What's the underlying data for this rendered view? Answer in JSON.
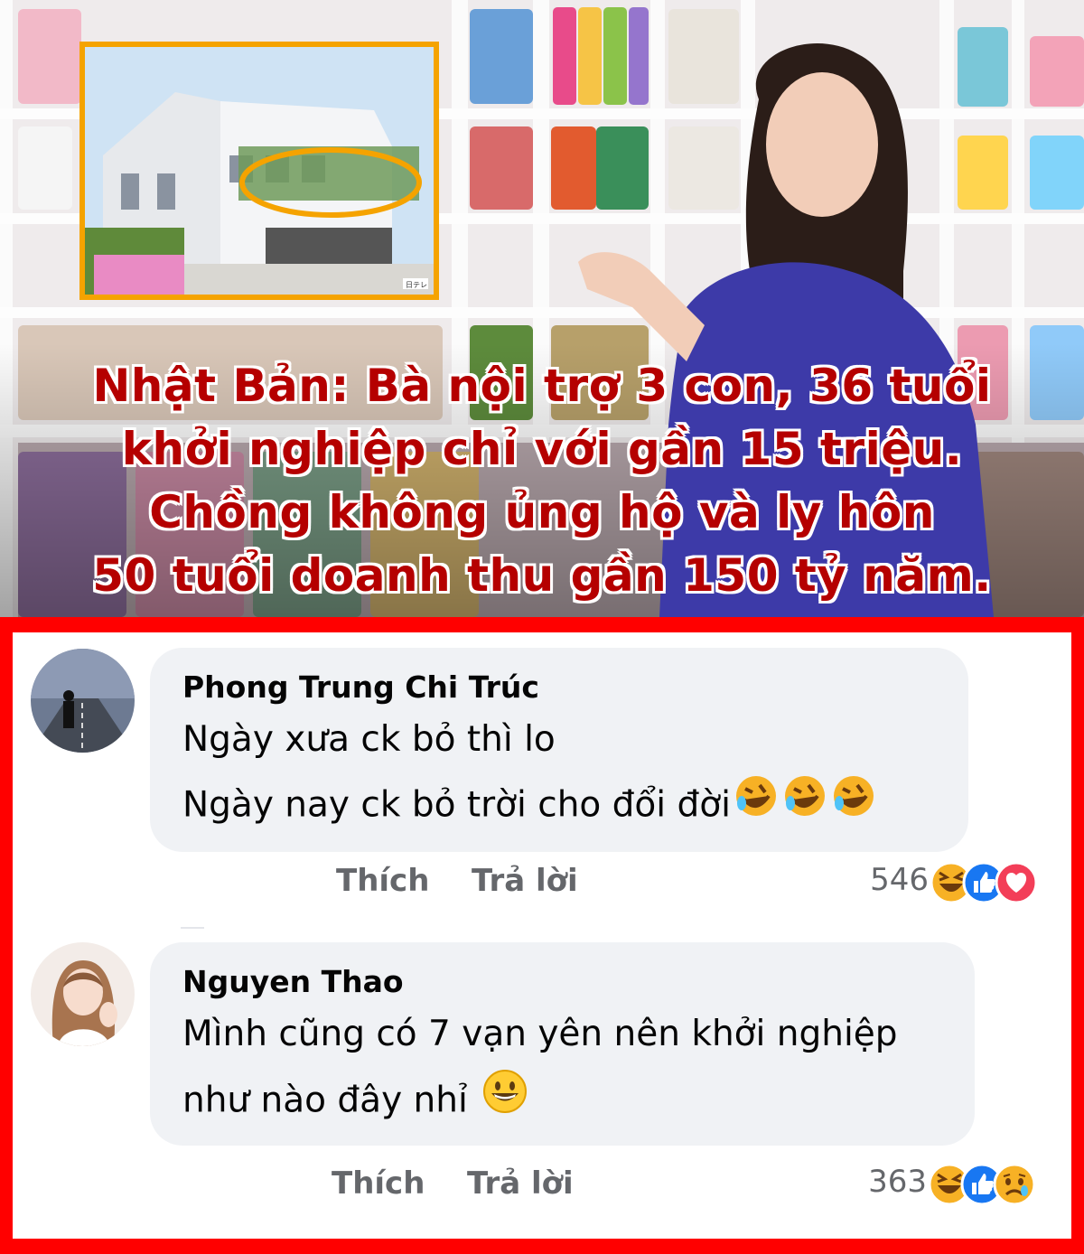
{
  "headline": {
    "lines": [
      "Nhật Bản: Bà nội trợ 3 con, 36 tuổi",
      "khởi nghiệp chỉ với gần 15 triệu.",
      "Chồng không ủng hộ và ly hôn",
      "50 tuổi doanh thu gần 150 tỷ năm."
    ],
    "color": "#b50000"
  },
  "inset": {
    "watermark": "日テレ"
  },
  "comments": [
    {
      "author": "Phong Trung Chi Trúc",
      "lines": [
        "Ngày xưa ck bỏ thì lo",
        "Ngày nay ck bỏ trời cho đổi đời"
      ],
      "trailing_emojis": [
        "rolling-on-floor-laughing",
        "rolling-on-floor-laughing",
        "rolling-on-floor-laughing"
      ],
      "like_label": "Thích",
      "reply_label": "Trả lời",
      "reaction_count": "546",
      "reaction_icons": [
        "haha",
        "like",
        "love"
      ]
    },
    {
      "author": "Nguyen Thao",
      "lines": [
        "Mình cũng có 7 vạn yên nên khởi nghiệp",
        "như nào đây nhỉ"
      ],
      "trailing_emojis": [
        "grinning-face"
      ],
      "like_label": "Thích",
      "reply_label": "Trả lời",
      "reaction_count": "363",
      "reaction_icons": [
        "haha",
        "like",
        "sad"
      ]
    }
  ],
  "colors": {
    "frame": "#ff0000",
    "bubble": "#f0f2f5",
    "muted_text": "#65676b",
    "inset_border": "#f5a300",
    "like_blue": "#1877f2",
    "love_red": "#f33e58",
    "haha_yellow": "#f7b125"
  }
}
